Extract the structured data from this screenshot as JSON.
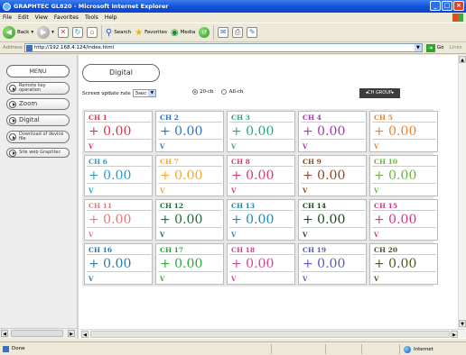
{
  "window": {
    "title": "GRAPHTEC GL820 - Microsoft Internet Explorer"
  },
  "menubar": [
    "File",
    "Edit",
    "View",
    "Favorites",
    "Tools",
    "Help"
  ],
  "toolbar": {
    "back": "Back",
    "search": "Search",
    "favorites": "Favorites",
    "media": "Media"
  },
  "address": {
    "label": "Address",
    "url": "http://192.168.4.124/index.html",
    "go": "Go",
    "links": "Links"
  },
  "sidebar": {
    "menu_title": "MENU",
    "items": [
      {
        "label": "Remote key operation",
        "small": true
      },
      {
        "label": "Zoom",
        "small": false
      },
      {
        "label": "Digital",
        "small": false
      },
      {
        "label": "Download of device file",
        "small": true
      },
      {
        "label": "Site web Graphtec",
        "small": true
      }
    ]
  },
  "main": {
    "title": "Digital",
    "update_label": "Screen update rate",
    "update_value": "5sec",
    "radio_20": "20-ch",
    "radio_all": "All-ch",
    "radio_selected": "20-ch",
    "group_button": "◂CH GROUP▸"
  },
  "channels": [
    {
      "name": "CH 1",
      "value": "+ 0.00",
      "unit": "V",
      "color": "#e0344a"
    },
    {
      "name": "CH 2",
      "value": "+ 0.00",
      "unit": "V",
      "color": "#2a72c4"
    },
    {
      "name": "CH 3",
      "value": "+ 0.00",
      "unit": "V",
      "color": "#28a878"
    },
    {
      "name": "CH 4",
      "value": "+ 0.00",
      "unit": "V",
      "color": "#a03aa8"
    },
    {
      "name": "CH 5",
      "value": "+ 0.00",
      "unit": "V",
      "color": "#f0802a"
    },
    {
      "name": "CH 6",
      "value": "+ 0.00",
      "unit": "V",
      "color": "#2a9ad4"
    },
    {
      "name": "CH 7",
      "value": "+ 0.00",
      "unit": "V",
      "color": "#f0a830"
    },
    {
      "name": "CH 8",
      "value": "+ 0.00",
      "unit": "V",
      "color": "#e0347a"
    },
    {
      "name": "CH 9",
      "value": "+ 0.00",
      "unit": "V",
      "color": "#8a4a2a"
    },
    {
      "name": "CH 10",
      "value": "+ 0.00",
      "unit": "V",
      "color": "#68b838"
    },
    {
      "name": "CH 11",
      "value": "+ 0.00",
      "unit": "V",
      "color": "#e87878"
    },
    {
      "name": "CH 12",
      "value": "+ 0.00",
      "unit": "V",
      "color": "#1f6a3a"
    },
    {
      "name": "CH 13",
      "value": "+ 0.00",
      "unit": "V",
      "color": "#1a8ab4"
    },
    {
      "name": "CH 14",
      "value": "+ 0.00",
      "unit": "V",
      "color": "#1a4a1a"
    },
    {
      "name": "CH 15",
      "value": "+ 0.00",
      "unit": "V",
      "color": "#d8348a"
    },
    {
      "name": "CH 16",
      "value": "+ 0.00",
      "unit": "V",
      "color": "#2a78b4"
    },
    {
      "name": "CH 17",
      "value": "+ 0.00",
      "unit": "V",
      "color": "#2aa838"
    },
    {
      "name": "CH 18",
      "value": "+ 0.00",
      "unit": "V",
      "color": "#d8409a"
    },
    {
      "name": "CH 19",
      "value": "+ 0.00",
      "unit": "V",
      "color": "#5a5ab8"
    },
    {
      "name": "CH 20",
      "value": "+ 0.00",
      "unit": "V",
      "color": "#4a5a1a"
    }
  ],
  "status": {
    "text": "Done",
    "zone": "Internet"
  }
}
